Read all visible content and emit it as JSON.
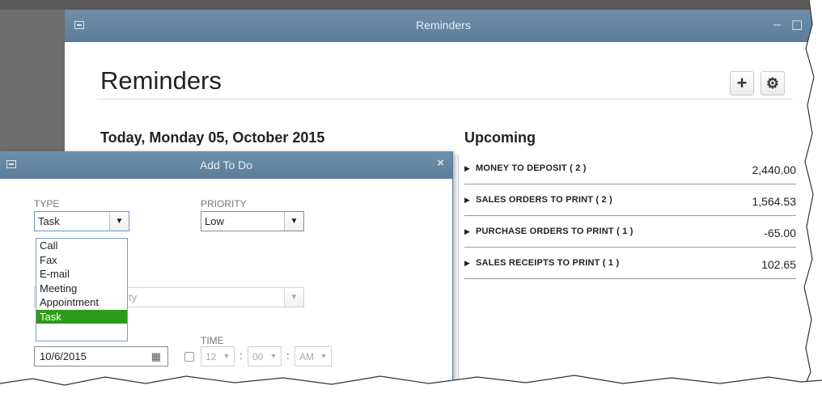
{
  "window": {
    "title": "Reminders",
    "controls": {
      "minimize": "–",
      "restore": "☐"
    }
  },
  "page": {
    "title": "Reminders",
    "add_icon": "+",
    "settings_icon": "⚙"
  },
  "today": {
    "heading": "Today, Monday 05, October 2015"
  },
  "upcoming": {
    "heading": "Upcoming",
    "items": [
      {
        "label": "MONEY TO DEPOSIT ( 2 )",
        "amount": "2,440.00"
      },
      {
        "label": "SALES ORDERS TO PRINT ( 2 )",
        "amount": "1,564.53"
      },
      {
        "label": "PURCHASE ORDERS TO PRINT ( 1 )",
        "amount": "-65.00"
      },
      {
        "label": "SALES RECEIPTS TO PRINT ( 1 )",
        "amount": "102.65"
      }
    ]
  },
  "dialog": {
    "title": "Add To Do",
    "close": "×",
    "type": {
      "label": "TYPE",
      "value": "Task",
      "options": [
        "Call",
        "Fax",
        "E-mail",
        "Meeting",
        "Appointment",
        "Task"
      ],
      "selected_option": "Task"
    },
    "priority": {
      "label": "PRIORITY",
      "value": "Low"
    },
    "with_partial": "ty",
    "date": {
      "value": "10/6/2015"
    },
    "time": {
      "label": "TIME",
      "hour": "12",
      "minute": "00",
      "ampm": "AM",
      "separator": ":"
    }
  },
  "colors": {
    "titlebar": "#5b7d9a",
    "selected_option": "#2e9a1a",
    "desktop": "#6e6e6e"
  }
}
